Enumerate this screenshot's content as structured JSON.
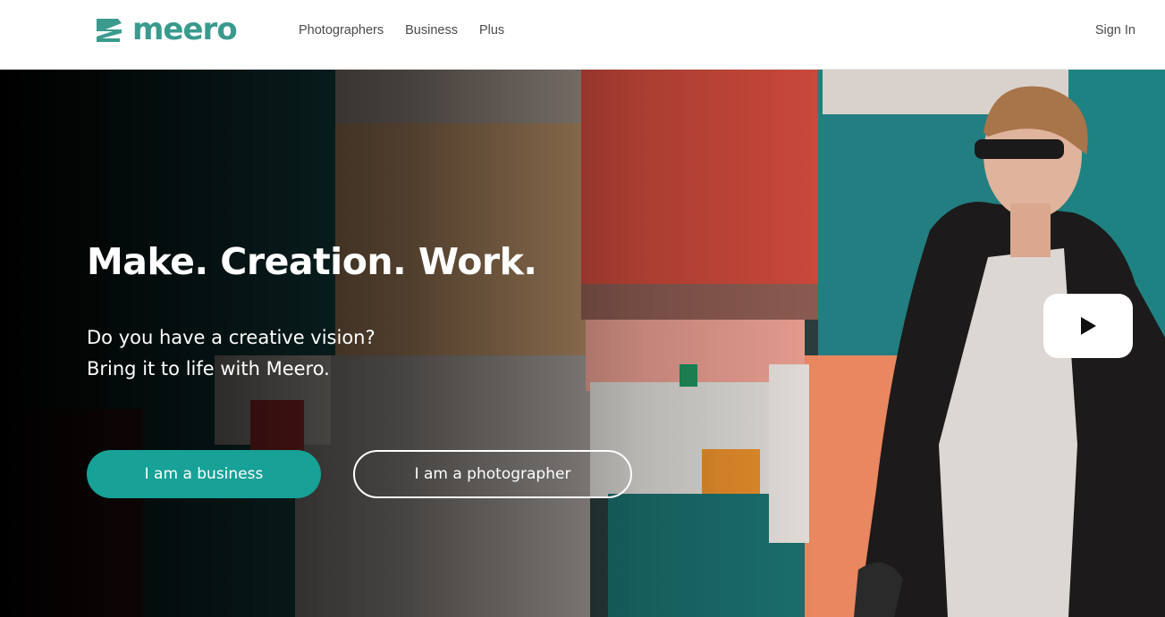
{
  "brand": {
    "name": "meero",
    "color": "#3a9a8e"
  },
  "nav": {
    "items": [
      {
        "label": "Photographers"
      },
      {
        "label": "Business"
      },
      {
        "label": "Plus"
      }
    ],
    "sign_in": "Sign In"
  },
  "hero": {
    "title": "Make. Creation. Work.",
    "subtitle_line1": "Do you have a creative vision?",
    "subtitle_line2": "Bring it to life with Meero.",
    "buttons": {
      "business": "I am a business",
      "photographer": "I am a photographer"
    },
    "accent_color": "#17a197",
    "play_icon": "play-icon"
  }
}
